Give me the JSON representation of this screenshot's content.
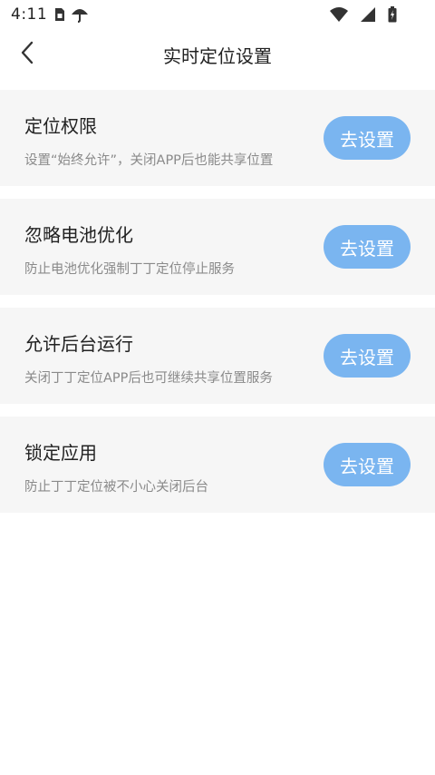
{
  "status_bar": {
    "time": "4:11"
  },
  "header": {
    "title": "实时定位设置"
  },
  "cards": [
    {
      "title": "定位权限",
      "desc": "设置“始终允许”，关闭APP后也能共享位置",
      "button": "去设置"
    },
    {
      "title": "忽略电池优化",
      "desc": "防止电池优化强制丁丁定位停止服务",
      "button": "去设置"
    },
    {
      "title": "允许后台运行",
      "desc": "关闭丁丁定位APP后也可继续共享位置服务",
      "button": "去设置"
    },
    {
      "title": "锁定应用",
      "desc": "防止丁丁定位被不小心关闭后台",
      "button": "去设置"
    }
  ],
  "colors": {
    "button_bg": "#7ab5f0",
    "card_bg": "#f6f6f6"
  }
}
